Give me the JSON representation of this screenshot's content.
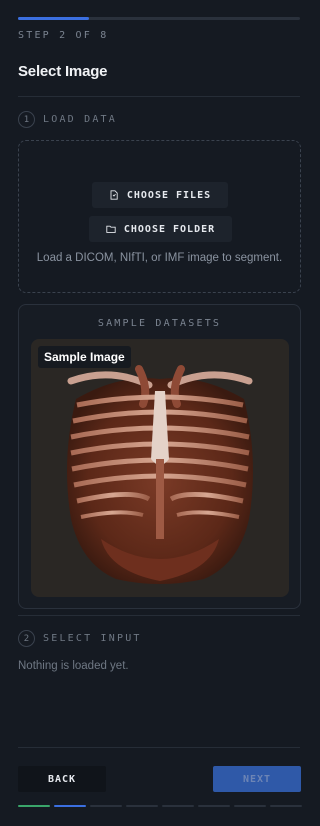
{
  "header": {
    "progress_fraction": 0.25,
    "step_label": "STEP 2 OF 8",
    "title": "Select Image"
  },
  "load_section": {
    "number": "1",
    "title": "LOAD DATA",
    "choose_files_label": "CHOOSE FILES",
    "choose_folder_label": "CHOOSE FOLDER",
    "hint": "Load a DICOM, NIfTI, or IMF image to segment."
  },
  "samples": {
    "title": "SAMPLE DATASETS",
    "items": [
      {
        "badge": "Sample Image"
      }
    ]
  },
  "input_section": {
    "number": "2",
    "title": "SELECT INPUT",
    "empty_text": "Nothing is loaded yet."
  },
  "footer": {
    "back_label": "BACK",
    "next_label": "NEXT",
    "step_dots": [
      {
        "state": "complete",
        "color": "#3aa56a"
      },
      {
        "state": "current",
        "color": "#3b6fe0"
      },
      {
        "state": "pending"
      },
      {
        "state": "pending"
      },
      {
        "state": "pending"
      },
      {
        "state": "pending"
      },
      {
        "state": "pending"
      },
      {
        "state": "pending"
      }
    ]
  },
  "colors": {
    "background": "#151a22",
    "accent": "#3b6fe0",
    "complete": "#3aa56a"
  }
}
